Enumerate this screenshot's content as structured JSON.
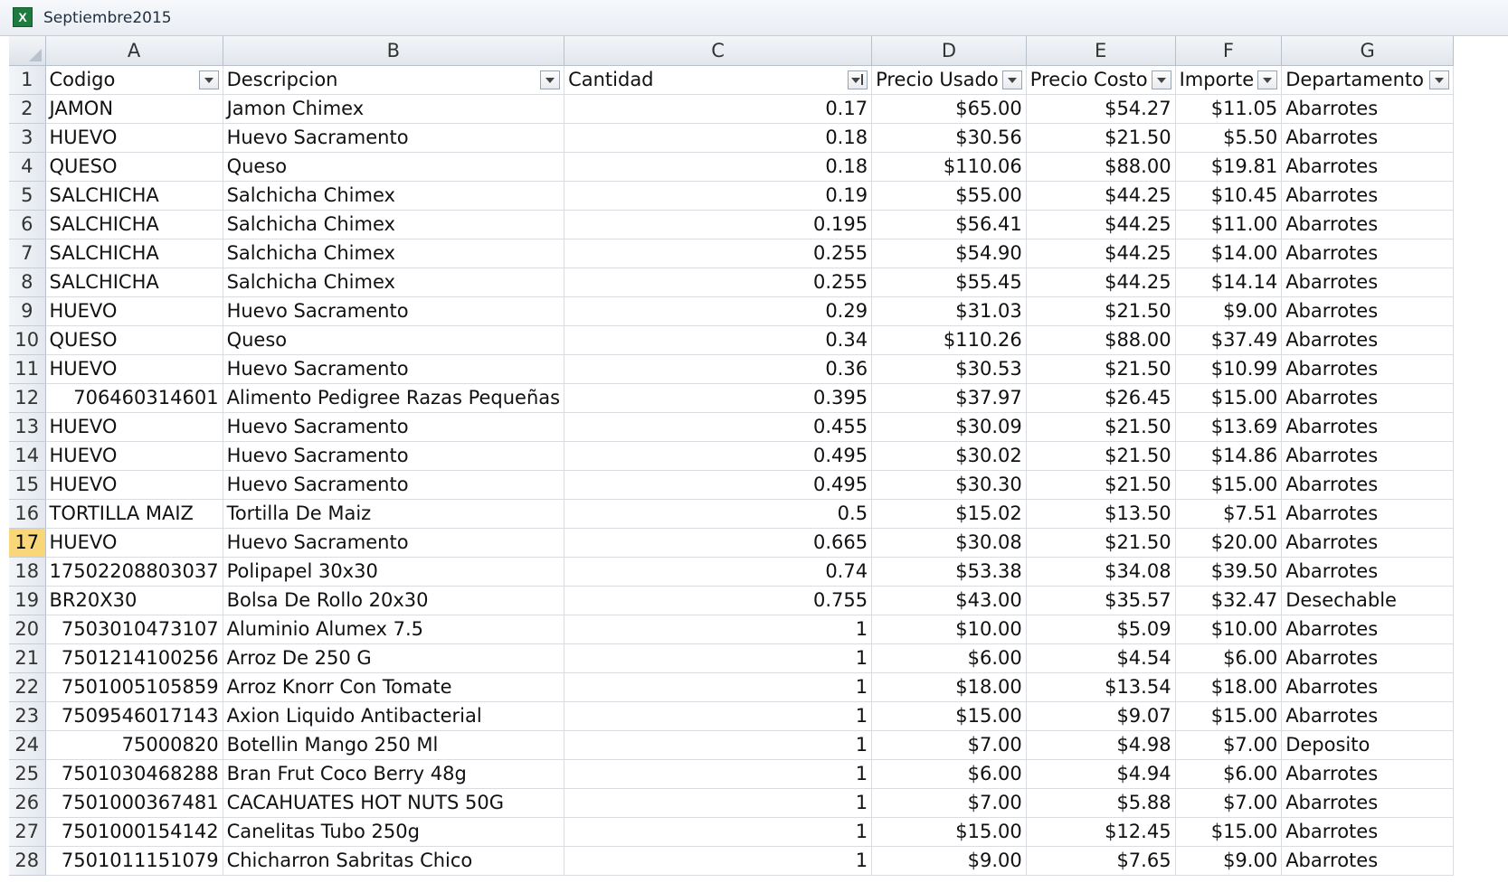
{
  "window": {
    "title": "Septiembre2015",
    "icon": "excel-icon"
  },
  "columns": [
    "A",
    "B",
    "C",
    "D",
    "E",
    "F",
    "G"
  ],
  "header": {
    "row_number": "1",
    "cells": [
      "Codigo",
      "Descripcion",
      "Cantidad",
      "Precio Usado",
      "Precio Costo",
      "Importe",
      "Departamento"
    ],
    "sorted_column": "Cantidad"
  },
  "active_row": "17",
  "rows": [
    {
      "n": "2",
      "a": "JAMON",
      "b": "Jamon Chimex",
      "c": "0.17",
      "d": "$65.00",
      "e": "$54.27",
      "f": "$11.05",
      "g": "Abarrotes"
    },
    {
      "n": "3",
      "a": "HUEVO",
      "b": "Huevo Sacramento",
      "c": "0.18",
      "d": "$30.56",
      "e": "$21.50",
      "f": "$5.50",
      "g": "Abarrotes"
    },
    {
      "n": "4",
      "a": "QUESO",
      "b": "Queso",
      "c": "0.18",
      "d": "$110.06",
      "e": "$88.00",
      "f": "$19.81",
      "g": "Abarrotes"
    },
    {
      "n": "5",
      "a": "SALCHICHA",
      "b": "Salchicha Chimex",
      "c": "0.19",
      "d": "$55.00",
      "e": "$44.25",
      "f": "$10.45",
      "g": "Abarrotes"
    },
    {
      "n": "6",
      "a": "SALCHICHA",
      "b": "Salchicha Chimex",
      "c": "0.195",
      "d": "$56.41",
      "e": "$44.25",
      "f": "$11.00",
      "g": "Abarrotes"
    },
    {
      "n": "7",
      "a": "SALCHICHA",
      "b": "Salchicha Chimex",
      "c": "0.255",
      "d": "$54.90",
      "e": "$44.25",
      "f": "$14.00",
      "g": "Abarrotes"
    },
    {
      "n": "8",
      "a": "SALCHICHA",
      "b": "Salchicha Chimex",
      "c": "0.255",
      "d": "$55.45",
      "e": "$44.25",
      "f": "$14.14",
      "g": "Abarrotes"
    },
    {
      "n": "9",
      "a": "HUEVO",
      "b": "Huevo Sacramento",
      "c": "0.29",
      "d": "$31.03",
      "e": "$21.50",
      "f": "$9.00",
      "g": "Abarrotes"
    },
    {
      "n": "10",
      "a": "QUESO",
      "b": "Queso",
      "c": "0.34",
      "d": "$110.26",
      "e": "$88.00",
      "f": "$37.49",
      "g": "Abarrotes"
    },
    {
      "n": "11",
      "a": "HUEVO",
      "b": "Huevo Sacramento",
      "c": "0.36",
      "d": "$30.53",
      "e": "$21.50",
      "f": "$10.99",
      "g": "Abarrotes"
    },
    {
      "n": "12",
      "a": "706460314601",
      "b": "Alimento  Pedigree Razas Pequeñas",
      "c": "0.395",
      "d": "$37.97",
      "e": "$26.45",
      "f": "$15.00",
      "g": "Abarrotes",
      "a_num": true
    },
    {
      "n": "13",
      "a": "HUEVO",
      "b": "Huevo Sacramento",
      "c": "0.455",
      "d": "$30.09",
      "e": "$21.50",
      "f": "$13.69",
      "g": "Abarrotes"
    },
    {
      "n": "14",
      "a": "HUEVO",
      "b": "Huevo Sacramento",
      "c": "0.495",
      "d": "$30.02",
      "e": "$21.50",
      "f": "$14.86",
      "g": "Abarrotes"
    },
    {
      "n": "15",
      "a": "HUEVO",
      "b": "Huevo Sacramento",
      "c": "0.495",
      "d": "$30.30",
      "e": "$21.50",
      "f": "$15.00",
      "g": "Abarrotes"
    },
    {
      "n": "16",
      "a": "TORTILLA MAIZ",
      "b": "Tortilla De Maiz",
      "c": "0.5",
      "d": "$15.02",
      "e": "$13.50",
      "f": "$7.51",
      "g": "Abarrotes"
    },
    {
      "n": "17",
      "a": "HUEVO",
      "b": "Huevo Sacramento",
      "c": "0.665",
      "d": "$30.08",
      "e": "$21.50",
      "f": "$20.00",
      "g": "Abarrotes"
    },
    {
      "n": "18",
      "a": "17502208803037",
      "b": "Polipapel 30x30",
      "c": "0.74",
      "d": "$53.38",
      "e": "$34.08",
      "f": "$39.50",
      "g": "Abarrotes",
      "a_num": true
    },
    {
      "n": "19",
      "a": "BR20X30",
      "b": "Bolsa De Rollo 20x30",
      "c": "0.755",
      "d": "$43.00",
      "e": "$35.57",
      "f": "$32.47",
      "g": "Desechable"
    },
    {
      "n": "20",
      "a": "7503010473107",
      "b": " Aluminio Alumex 7.5",
      "c": "1",
      "d": "$10.00",
      "e": "$5.09",
      "f": "$10.00",
      "g": "Abarrotes",
      "a_num": true
    },
    {
      "n": "21",
      "a": "7501214100256",
      "b": "Arroz De 250 G",
      "c": "1",
      "d": "$6.00",
      "e": "$4.54",
      "f": "$6.00",
      "g": "Abarrotes",
      "a_num": true
    },
    {
      "n": "22",
      "a": "7501005105859",
      "b": "Arroz Knorr Con Tomate",
      "c": "1",
      "d": "$18.00",
      "e": "$13.54",
      "f": "$18.00",
      "g": "Abarrotes",
      "a_num": true
    },
    {
      "n": "23",
      "a": "7509546017143",
      "b": "Axion Liquido Antibacterial",
      "c": "1",
      "d": "$15.00",
      "e": "$9.07",
      "f": "$15.00",
      "g": "Abarrotes",
      "a_num": true
    },
    {
      "n": "24",
      "a": "75000820",
      "b": "Botellin Mango 250 Ml",
      "c": "1",
      "d": "$7.00",
      "e": "$4.98",
      "f": "$7.00",
      "g": "Deposito",
      "a_num": true
    },
    {
      "n": "25",
      "a": "7501030468288",
      "b": "Bran Frut Coco Berry 48g",
      "c": "1",
      "d": "$6.00",
      "e": "$4.94",
      "f": "$6.00",
      "g": "Abarrotes",
      "a_num": true
    },
    {
      "n": "26",
      "a": "7501000367481",
      "b": "CACAHUATES HOT NUTS 50G",
      "c": "1",
      "d": "$7.00",
      "e": "$5.88",
      "f": "$7.00",
      "g": "Abarrotes",
      "a_num": true
    },
    {
      "n": "27",
      "a": "7501000154142",
      "b": "Canelitas Tubo 250g",
      "c": "1",
      "d": "$15.00",
      "e": "$12.45",
      "f": "$15.00",
      "g": "Abarrotes",
      "a_num": true
    },
    {
      "n": "28",
      "a": "7501011151079",
      "b": "Chicharron Sabritas Chico",
      "c": "1",
      "d": "$9.00",
      "e": "$7.65",
      "f": "$9.00",
      "g": "Abarrotes",
      "a_num": true
    }
  ]
}
